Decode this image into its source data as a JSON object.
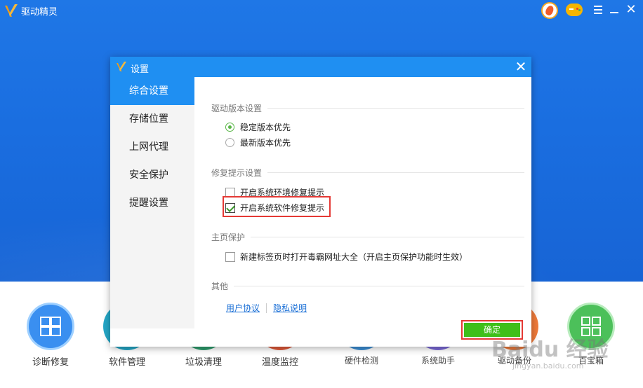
{
  "app": {
    "title": "驱动精灵"
  },
  "dialog": {
    "title": "设置",
    "close_glyph": "✕",
    "sidebar": [
      {
        "label": "综合设置",
        "active": true
      },
      {
        "label": "存储位置",
        "active": false
      },
      {
        "label": "上网代理",
        "active": false
      },
      {
        "label": "安全保护",
        "active": false
      },
      {
        "label": "提醒设置",
        "active": false
      }
    ],
    "sections": {
      "version": {
        "title": "驱动版本设置",
        "options": [
          {
            "label": "稳定版本优先",
            "selected": true
          },
          {
            "label": "最新版本优先",
            "selected": false
          }
        ]
      },
      "repair": {
        "title": "修复提示设置",
        "options": [
          {
            "label": "开启系统环境修复提示",
            "checked": false
          },
          {
            "label": "开启系统软件修复提示",
            "checked": true
          }
        ]
      },
      "homepage": {
        "title": "主页保护",
        "option": {
          "label": "新建标签页时打开毒霸网址大全（开启主页保护功能时生效）",
          "checked": false
        }
      },
      "other": {
        "title": "其他",
        "links": [
          "用户协议",
          "隐私说明"
        ]
      }
    },
    "ok_label": "确定"
  },
  "tools": [
    {
      "label": "诊断修复",
      "color": "#3a8ff0"
    },
    {
      "label": "软件管理",
      "color": "#25a7c7"
    },
    {
      "label": "垃圾清理",
      "color": "#2e9e6e"
    },
    {
      "label": "温度监控",
      "color": "#e05a3a"
    },
    {
      "label": "硬件检测",
      "color": "#3b8fd6"
    },
    {
      "label": "系统助手",
      "color": "#7b6ad8"
    },
    {
      "label": "驱动备份",
      "color": "#f07a3a"
    },
    {
      "label": "百宝箱",
      "color": "#4cc05a"
    }
  ],
  "watermark": {
    "main": "Baidu 经验",
    "sub": "jingyan.baidu.com"
  },
  "colors": {
    "accent": "#1f8ff2",
    "highlight": "#e53935",
    "ok": "#3fbf1a"
  }
}
